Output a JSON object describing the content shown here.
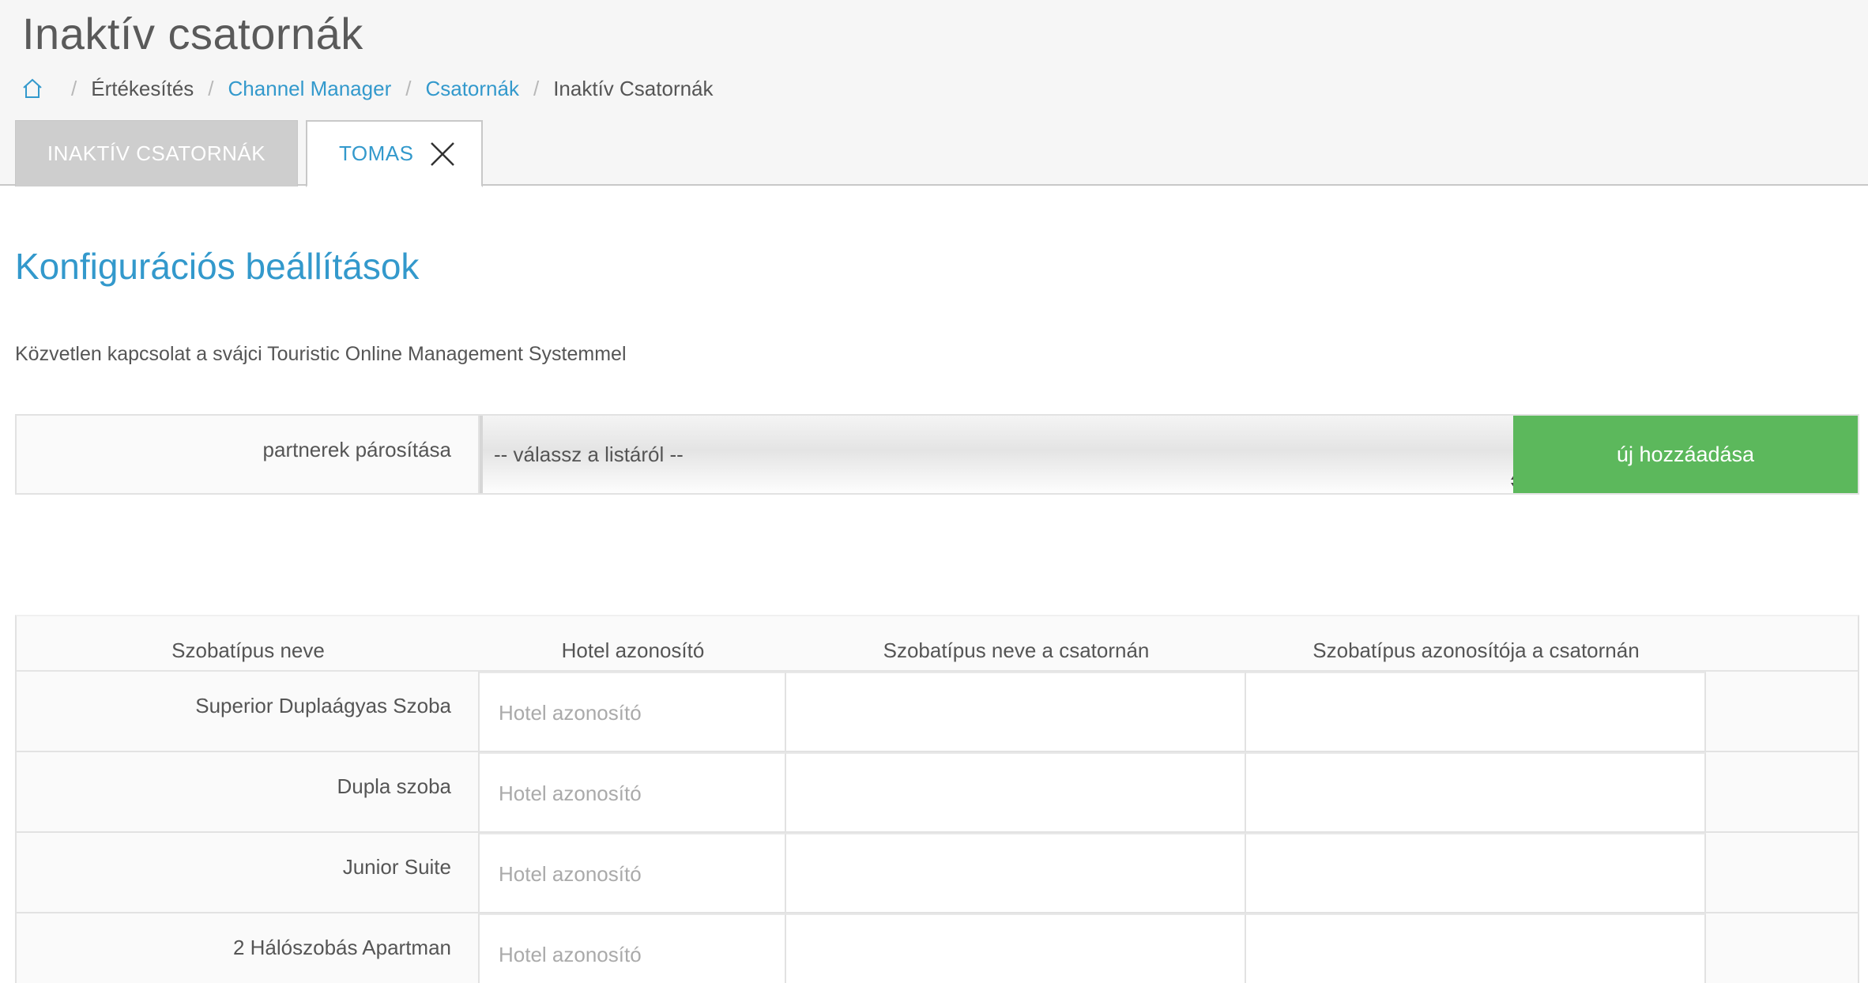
{
  "page": {
    "title": "Inaktív csatornák"
  },
  "breadcrumb": {
    "home_icon": "home-icon",
    "items": [
      {
        "label": "Értékesítés",
        "link": false
      },
      {
        "label": "Channel Manager",
        "link": true
      },
      {
        "label": "Csatornák",
        "link": true
      },
      {
        "label": "Inaktív Csatornák",
        "link": false
      }
    ],
    "separator": "/"
  },
  "tabs": [
    {
      "label": "INAKTÍV CSATORNÁK",
      "active": false
    },
    {
      "label": "TOMAS",
      "active": true,
      "close_icon": "close-icon"
    }
  ],
  "section": {
    "title": "Konfigurációs beállítások",
    "description": "Közvetlen kapcsolat a svájci Touristic Online Management Systemmel"
  },
  "pairing": {
    "label": "partnerek párosítása",
    "select_value": "-- válassz a listáról --",
    "add_button": "új hozzáadása"
  },
  "table": {
    "headers": [
      "Szobatípus neve",
      "Hotel azonosító",
      "Szobatípus neve a csatornán",
      "Szobatípus azonosítója a csatornán"
    ],
    "input_placeholder": "Hotel azonosító",
    "rows": [
      {
        "room": "Superior Duplaágyas Szoba"
      },
      {
        "room": "Dupla szoba"
      },
      {
        "room": "Junior Suite"
      },
      {
        "room": "2 Hálószobás Apartman"
      }
    ]
  },
  "colors": {
    "accent": "#3399cc",
    "button_green": "#5cb85c",
    "inactive_tab": "#cecece"
  }
}
